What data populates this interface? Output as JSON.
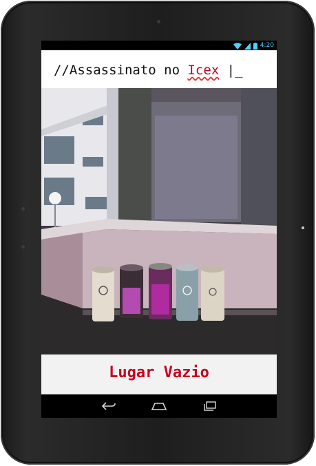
{
  "status_bar": {
    "time": "4:20",
    "icons": [
      "wifi-icon",
      "signal-icon",
      "battery-icon"
    ],
    "accent_color": "#4fd1ff"
  },
  "app": {
    "title_prefix": "//Assassinato no ",
    "title_highlight": "Icex",
    "title_suffix": " |_",
    "title_highlight_color": "#c8001e"
  },
  "scene": {
    "image_content": "photo-courtyard-recycling-bins"
  },
  "caption": {
    "text": "Lugar Vazio",
    "color": "#c8001e"
  },
  "nav_bar": {
    "buttons": [
      "back-icon",
      "home-icon",
      "recent-apps-icon"
    ]
  }
}
